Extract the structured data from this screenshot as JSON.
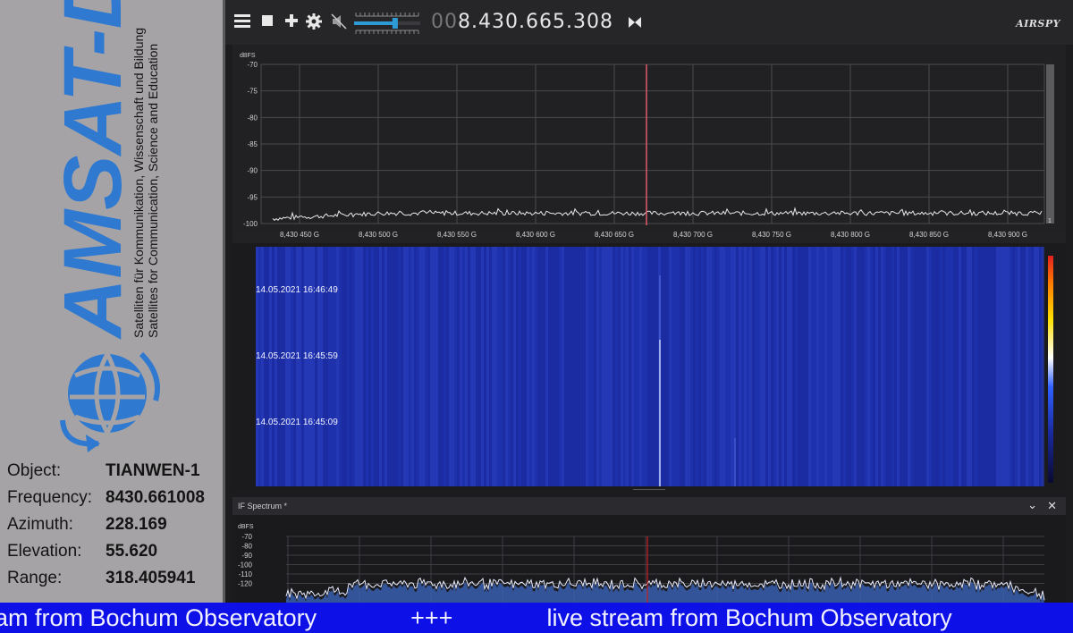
{
  "logo": {
    "name": "AMSAT-DL",
    "tagline_de": "Satelliten für Kommunikation, Wissenschaft und Bildung",
    "tagline_en": "Satellites for Communication, Science and Education"
  },
  "info": [
    {
      "label": "Object:",
      "value": "TIANWEN-1"
    },
    {
      "label": "Frequency:",
      "value": "8430.661008"
    },
    {
      "label": "Azimuth:",
      "value": "228.169"
    },
    {
      "label": "Elevation:",
      "value": "55.620"
    },
    {
      "label": "Range:",
      "value": "318.405941"
    }
  ],
  "toolbar": {
    "menu_icon": "hamburger-icon",
    "stop_icon": "stop-icon",
    "add_icon": "plus-icon",
    "settings_icon": "gear-icon",
    "mute_icon": "speaker-muted-icon",
    "volume_level": 0.62,
    "frequency_prefix": "00",
    "frequency_main": "8.430.665.308",
    "tune_icon": "bowtie-icon",
    "brand": "AIRSPY"
  },
  "spectrum": {
    "unit": "dBFS",
    "y_ticks": [
      "-70",
      "-75",
      "-80",
      "-85",
      "-90",
      "-95",
      "-100"
    ],
    "x_ticks": [
      "8,430 450 G",
      "8,430 500 G",
      "8,430 550 G",
      "8,430 600 G",
      "8,430 650 G",
      "8,430 700 G",
      "8,430 750 G",
      "8,430 800 G",
      "8,430 850 G",
      "8,430 900 G"
    ],
    "marker_color": "#e05a6a",
    "trace_color": "#e8e8e8"
  },
  "waterfall": {
    "timestamps": [
      "14.05.2021 16:46:49",
      "14.05.2021 16:45:59",
      "14.05.2021 16:45:09"
    ],
    "background_color": "#1d2fa8"
  },
  "if_spectrum": {
    "title": "IF Spectrum *",
    "maximize_icon": "chevron-down-icon",
    "close_icon": "close-icon",
    "unit": "dBFS",
    "y_ticks": [
      "-70",
      "-80",
      "-90",
      "-100",
      "-110",
      "-120"
    ],
    "fill_color": "#3a5fb0",
    "marker_color": "#c81e1e"
  },
  "ticker": {
    "text": "am from Bochum Observatory              +++              live stream from Bochum Observatory"
  }
}
